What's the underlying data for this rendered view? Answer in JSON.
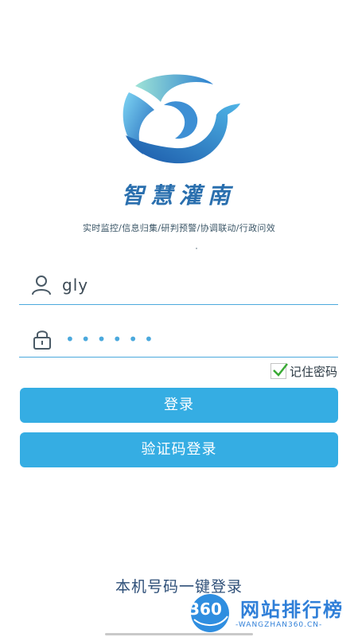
{
  "app": {
    "title": "智慧灌南",
    "slogan": "实时监控/信息归集/研判预警/协调联动/行政问效",
    "logo_icon": "swirl-leaf-logo"
  },
  "login_form": {
    "username": {
      "value": "gly",
      "icon": "user-icon"
    },
    "password": {
      "masked_value": "••••••",
      "icon": "lock-icon"
    },
    "remember": {
      "label": "记住密码",
      "checked": true
    },
    "login_label": "登录",
    "sms_login_label": "验证码登录",
    "one_click_label": "本机号码一键登录"
  },
  "watermark": {
    "badge": "360",
    "title": "网站排行榜",
    "subtitle": "-WANGZHAN360.CN-"
  },
  "colors": {
    "accent": "#35ade3",
    "underline": "#4ba9dd",
    "title_blue": "#2a6fae",
    "watermark_blue": "#2f7fd8"
  }
}
